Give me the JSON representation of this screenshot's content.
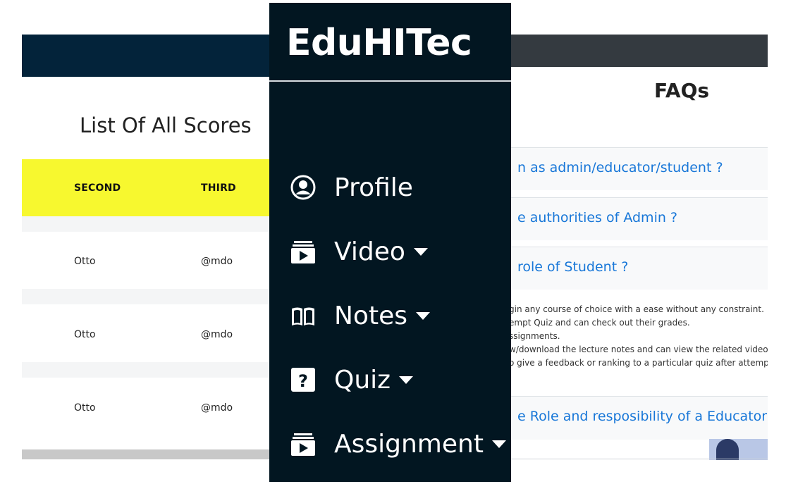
{
  "scores": {
    "title": "List Of All Scores",
    "columns": [
      "SECOND",
      "THIRD"
    ],
    "rows": [
      [
        "Otto",
        "@mdo"
      ],
      [
        "Otto",
        "@mdo"
      ],
      [
        "Otto",
        "@mdo"
      ]
    ],
    "header_color": "#03233a",
    "thead_color": "#f7f82f"
  },
  "sidebar": {
    "brand": "EduHITec",
    "items": [
      {
        "label": "Profile",
        "icon": "user-circle-icon",
        "dropdown": false
      },
      {
        "label": "Video",
        "icon": "video-player-icon",
        "dropdown": true
      },
      {
        "label": "Notes",
        "icon": "book-icon",
        "dropdown": true
      },
      {
        "label": "Quiz",
        "icon": "question-box-icon",
        "dropdown": true
      },
      {
        "label": "Assignment",
        "icon": "video-player-icon",
        "dropdown": true
      }
    ],
    "background": "#021621"
  },
  "faq": {
    "title": "FAQs",
    "questions": [
      "n as admin/educator/student ?",
      "e authorities of Admin ?",
      "role of Student ?",
      "e Role and resposibility of a Educator ?"
    ],
    "answer_lines": [
      "gin any course of choice with a ease without any constraint.",
      "empt Quiz and can check out their grades.",
      "ssignments.",
      "w/download the lecture notes and can view the related videos",
      "o give a feedback or ranking to a particular quiz after attemptir"
    ],
    "link_color": "#1877d8",
    "header_color": "#343a40"
  }
}
